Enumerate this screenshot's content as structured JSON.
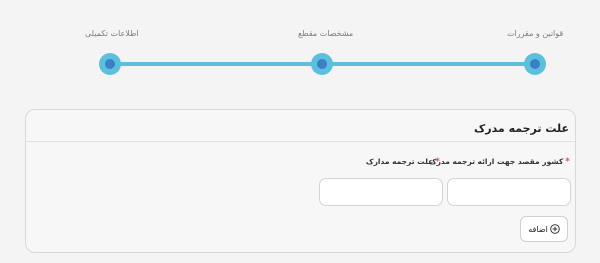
{
  "stepper": {
    "steps": [
      {
        "label": "قوانین و مقررات"
      },
      {
        "label": "مشخصات مقطع"
      },
      {
        "label": "اطلاعات تکمیلی"
      }
    ]
  },
  "card": {
    "title": "علت ترجمه مدرک",
    "fields": [
      {
        "label": "کشور مقصد جهت ارائه ترجمه مدرک",
        "required_mark": "*",
        "value": ""
      },
      {
        "label": "علت ترجمه مدارک",
        "required_mark": "*",
        "value": ""
      }
    ],
    "add_button": {
      "label": "اضافه",
      "icon": "plus-circle-icon"
    }
  },
  "colors": {
    "stepper_accent": "#5bc0de",
    "stepper_dot_inner": "#3a7fc4",
    "required": "#d9534f"
  }
}
